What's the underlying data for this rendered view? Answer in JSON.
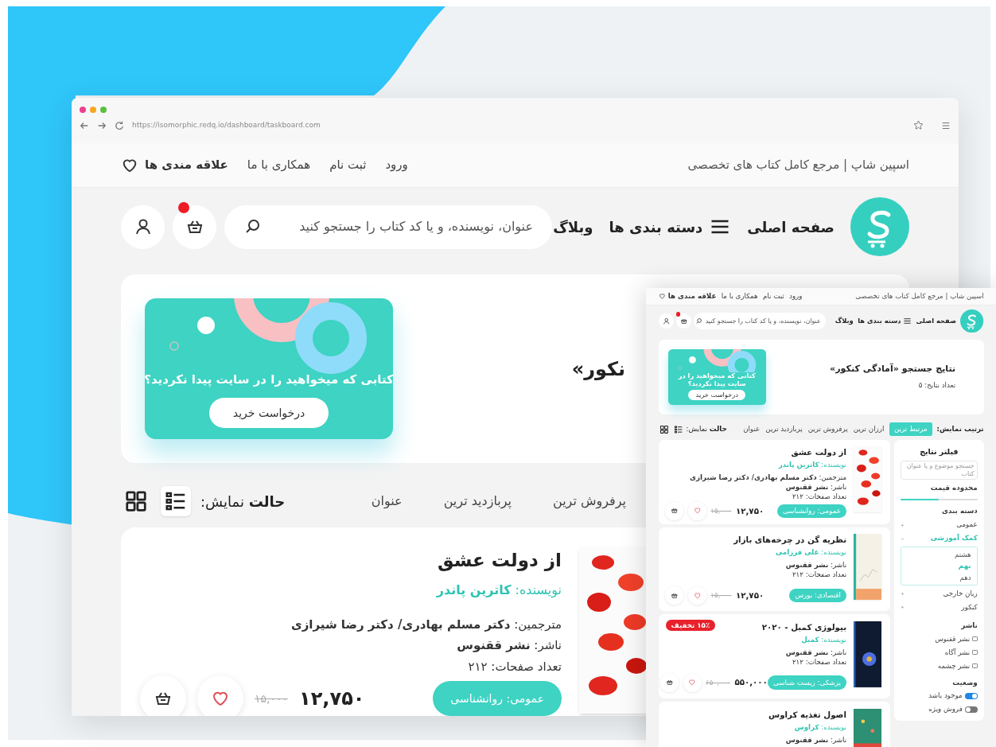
{
  "browser": {
    "url": "https://isomorphic.redq.io/dashboard/taskboard.com"
  },
  "page": {
    "top_bar": {
      "tagline": "اسپین شاپ | مرجع کامل کتاب های تخصصی",
      "links": [
        "ورود",
        "ثبت نام",
        "همکاری با ما"
      ],
      "wishlist": "علاقه مندی ها"
    },
    "nav": {
      "items": [
        {
          "label": "صفحه اصلی",
          "kind": "home"
        },
        {
          "label": "دسته بندی ها",
          "kind": "menu"
        },
        {
          "label": "وبلاگ",
          "kind": "link"
        }
      ],
      "search_placeholder": "عنوان، نویسنده، و یا کد کتاب را جستجو کنید",
      "cart_notification": true
    },
    "banner": {
      "heading": "نکور»",
      "promo_text": "کتابی که میخواهید را در سایت پیدا نکردید؟",
      "promo_button": "درخواست خرید"
    },
    "sort": {
      "options": [
        {
          "label": "پرفروش ترین",
          "selected": false
        },
        {
          "label": "پربازدید ترین",
          "selected": false
        },
        {
          "label": "عنوان",
          "selected": false
        }
      ],
      "view_label": "**حالت** نمایش:",
      "view_modes": [
        {
          "kind": "list",
          "selected": true
        },
        {
          "kind": "grid",
          "selected": false
        }
      ]
    },
    "cards": [
      {
        "kind": "petals",
        "title": "از دولت عشق",
        "author": "نویسنده: **کاترین پاندر**",
        "meta": [
          "مترجمین: **دکتر مسلم بهادری/ دکتر رضا شیرازی**",
          "ناشر: **نشر ققنوس**",
          "تعداد صفحات: ۲۱۲"
        ],
        "tag": "عمومی: روانشناسی",
        "price": "۱۲,۷۵۰",
        "old_price": "۱۵,۰۰۰"
      }
    ]
  },
  "inset_page": {
    "top_bar": {
      "tagline": "اسپین شاپ | مرجع کامل کتاب های تخصصی",
      "links": [
        "ورود",
        "ثبت نام",
        "همکاری با ما"
      ],
      "wishlist": "علاقه مندی ها"
    },
    "nav": {
      "items": [
        {
          "label": "صفحه اصلی",
          "kind": "home"
        },
        {
          "label": "دسته بندی ها",
          "kind": "menu"
        },
        {
          "label": "وبلاگ",
          "kind": "link"
        }
      ],
      "search_placeholder": "عنوان، نویسنده، و یا کد کتاب را جستجو کنید",
      "cart_notification": true
    },
    "banner": {
      "heading": "نتایج جستجو «آمادگی کنکور»",
      "count": "تعداد نتایج: ۵",
      "promo_text": "کتابی که میخواهید را در سایت پیدا نکردید؟",
      "promo_button": "درخواست خرید"
    },
    "sort": {
      "label": "ترتیب نمایش:",
      "options": [
        {
          "label": "مرتبط ترین",
          "selected": true
        },
        {
          "label": "ارزان ترین",
          "selected": false
        },
        {
          "label": "پرفروش ترین",
          "selected": false
        },
        {
          "label": "پربازدید ترین",
          "selected": false
        },
        {
          "label": "عنوان",
          "selected": false
        }
      ],
      "view_label": "**حالت** نمایش:",
      "view_modes": [
        {
          "kind": "list",
          "selected": false
        },
        {
          "kind": "grid",
          "selected": false
        }
      ]
    },
    "filter": {
      "title": "فیلتر نتایج",
      "search_placeholder": "جستجو موضوع و یا عنوان کتاب",
      "price_title": "محدوده قیمت",
      "price_slider": {
        "level": 0.5
      },
      "category_title": "دسته بندی",
      "categories": [
        {
          "label": "عمومی",
          "selected": false,
          "expanded": false
        },
        {
          "label": "کمک آموزشی",
          "selected": true,
          "expanded": true,
          "children": [
            {
              "label": "هشتم",
              "selected": false
            },
            {
              "label": "نهم",
              "selected": true
            },
            {
              "label": "دهم",
              "selected": false
            }
          ]
        },
        {
          "label": "زبان خارجی",
          "selected": false,
          "expanded": false
        },
        {
          "label": "کنکور",
          "selected": false,
          "expanded": false
        }
      ],
      "publisher_title": "ناشر",
      "publishers": [
        {
          "label": "نشر ققنوس",
          "checked": false
        },
        {
          "label": "نشر آگاه",
          "checked": false
        },
        {
          "label": "نشر چشمه",
          "checked": false
        }
      ],
      "status_title": "وضعیت",
      "toggles": [
        {
          "label": "موجود باشد",
          "on": true
        },
        {
          "label": "فروش ویژه",
          "on": false
        }
      ]
    },
    "cards": [
      {
        "kind": "petals",
        "title": "از دولت عشق",
        "author": "نویسنده: **کاترین پاندر**",
        "meta": [
          "مترجمین: **دکتر مسلم بهادری/ دکتر رضا شیرازی**",
          "ناشر: **نشر ققنوس**",
          "تعداد صفحات: ۲۱۲"
        ],
        "tag": "عمومی: روانشناسی",
        "price": "۱۲,۷۵۰",
        "old_price": "۱۵,۰۰۰"
      },
      {
        "kind": "chart",
        "title": "نظریه گن در چرخه‌های بازار",
        "author": "نویسنده: **علی فرزامی**",
        "meta": [
          "ناشر: **نشر ققنوس**",
          "تعداد صفحات: ۲۱۲"
        ],
        "tag": "اقتصادی: بورس",
        "price": "۱۲,۷۵۰",
        "old_price": "۱۵,۰۰۰"
      },
      {
        "kind": "flower",
        "title": "بیولوژی کمبل - ۲۰۲۰",
        "author": "نویسنده: **کمبل**",
        "meta": [
          "ناشر: **نشر ققنوس**",
          "تعداد صفحات: ۲۱۲"
        ],
        "tag": "پزشکی: زیست شناسی",
        "price": "۵۵۰,۰۰۰",
        "old_price": "۶۵۰,۰۰۰",
        "badge": "۱۵٪ تخفیف"
      },
      {
        "kind": "pattern",
        "title": "اصول تغذیه کراوس",
        "author": "نویسنده: **کراوس**",
        "meta": [
          "ناشر: **نشر ققنوس**"
        ]
      }
    ]
  }
}
